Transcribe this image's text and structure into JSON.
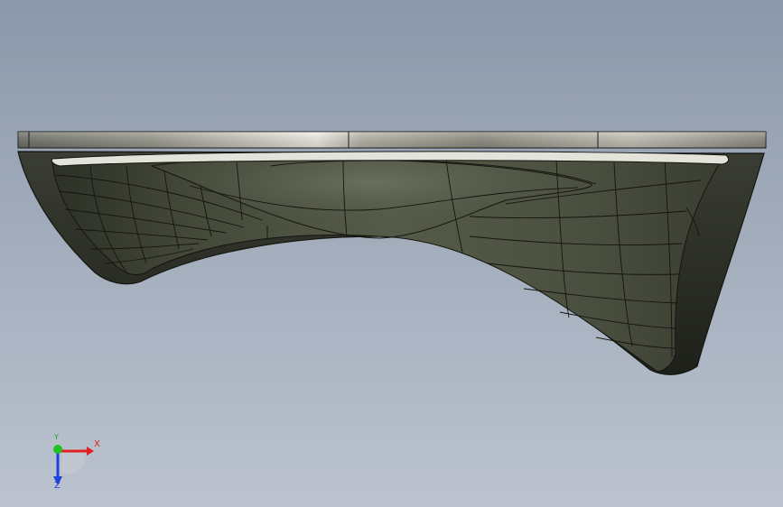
{
  "viewport": {
    "background_top": "#8c98aa",
    "background_bottom": "#bcc3cf"
  },
  "model": {
    "surface_color": "#4b5041",
    "rim_color": "#23261f",
    "edge_color": "#14160f",
    "plate_highlight": "#f4f2ea"
  },
  "triad": {
    "x_label": "X",
    "y_label": "Y",
    "z_label": "Z",
    "x_color": "#e02020",
    "y_color": "#20c020",
    "z_color": "#2040e0"
  }
}
